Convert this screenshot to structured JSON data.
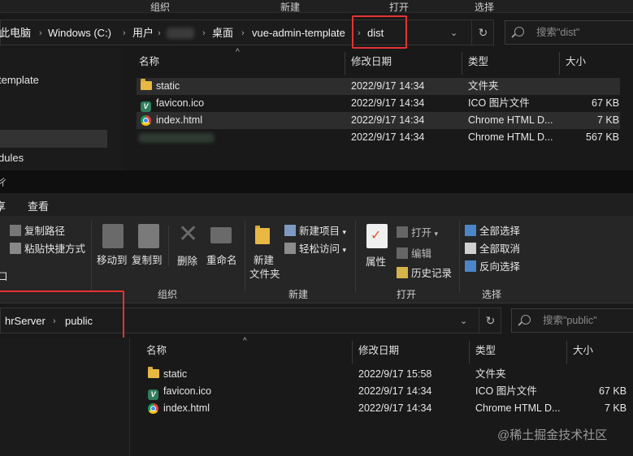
{
  "top_window": {
    "ribbon_groups": [
      "组织",
      "新建",
      "打开",
      "选择"
    ],
    "breadcrumbs": [
      "此电脑",
      "Windows (C:)",
      "用户",
      "桌面",
      "vue-admin-template",
      "dist"
    ],
    "search_placeholder": "搜索\"dist\"",
    "nav_items": [
      "template",
      "dules"
    ],
    "columns": [
      "名称",
      "修改日期",
      "类型",
      "大小"
    ],
    "files": [
      {
        "name": "static",
        "date": "2022/9/17 14:34",
        "type": "文件夹",
        "size": "",
        "icon": "folder-icon"
      },
      {
        "name": "favicon.ico",
        "date": "2022/9/17 14:34",
        "type": "ICO 图片文件",
        "size": "67 KB",
        "icon": "vue-icon"
      },
      {
        "name": "index.html",
        "date": "2022/9/17 14:34",
        "type": "Chrome HTML D...",
        "size": "7 KB",
        "icon": "chrome-icon"
      },
      {
        "name": "",
        "date": "2022/9/17 14:34",
        "type": "Chrome HTML D...",
        "size": "567 KB",
        "icon": "blurred-icon"
      }
    ]
  },
  "bottom_window": {
    "tabs": [
      "享",
      "查看"
    ],
    "ribbon": {
      "copy_path": "复制路径",
      "paste_shortcut": "粘贴快捷方式",
      "move_to": "移动到",
      "copy_to": "复制到",
      "delete": "删除",
      "rename": "重命名",
      "new_folder": "新建\n文件夹",
      "new_folder_line1": "新建",
      "new_folder_line2": "文件夹",
      "new_item": "新建项目",
      "easy_access": "轻松访问",
      "properties": "属性",
      "open": "打开",
      "edit": "编辑",
      "history": "历史记录",
      "select_all": "全部选择",
      "select_none": "全部取消",
      "invert_selection": "反向选择",
      "left_clip": "口"
    },
    "ribbon_groups": [
      "组织",
      "新建",
      "打开",
      "选择"
    ],
    "breadcrumbs": [
      "hrServer",
      "public"
    ],
    "search_placeholder": "搜索\"public\"",
    "columns": [
      "名称",
      "修改日期",
      "类型",
      "大小"
    ],
    "files": [
      {
        "name": "static",
        "date": "2022/9/17 15:58",
        "type": "文件夹",
        "size": "",
        "icon": "folder-icon"
      },
      {
        "name": "favicon.ico",
        "date": "2022/9/17 14:34",
        "type": "ICO 图片文件",
        "size": "67 KB",
        "icon": "vue-icon"
      },
      {
        "name": "index.html",
        "date": "2022/9/17 14:34",
        "type": "Chrome HTML D...",
        "size": "7 KB",
        "icon": "chrome-icon"
      }
    ]
  },
  "watermark": "@稀土掘金技术社区",
  "colors": {
    "highlight": "#e53333",
    "folder": "#e8b843",
    "background": "#191919"
  }
}
